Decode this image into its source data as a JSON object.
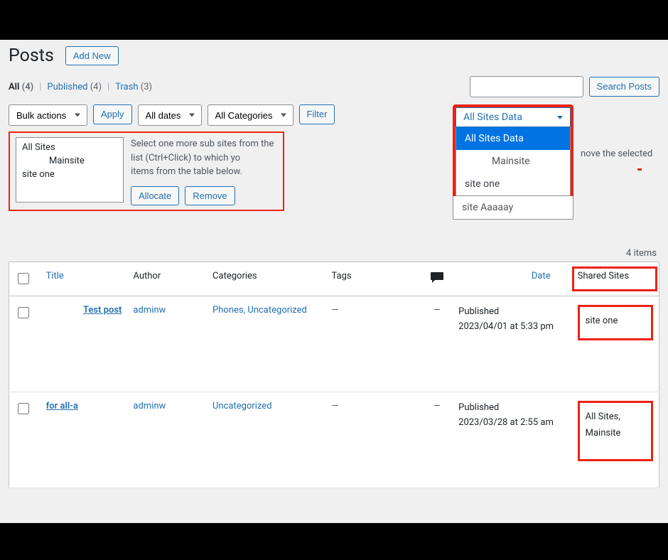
{
  "page": {
    "title": "Posts",
    "add_new": "Add New"
  },
  "views": {
    "all_label": "All",
    "all_count": "(4)",
    "published_label": "Published",
    "published_count": "(4)",
    "trash_label": "Trash",
    "trash_count": "(3)"
  },
  "search": {
    "placeholder": "",
    "button": "Search Posts"
  },
  "filters": {
    "bulk_actions": "Bulk actions",
    "apply": "Apply",
    "all_dates": "All dates",
    "all_categories": "All Categories",
    "filter": "Filter"
  },
  "allocate_panel": {
    "options": [
      "All Sites",
      "Mainsite",
      "site one"
    ],
    "help_text": "Select one more sub sites from the list (Ctrl+Click) to which yo",
    "help_text2": "items from the table below.",
    "behind_text": "nove the selected",
    "allocate_btn": "Allocate",
    "remove_btn": "Remove"
  },
  "sites_dropdown": {
    "trigger": "All Sites Data",
    "options": [
      "All Sites Data",
      "Mainsite",
      "site one"
    ],
    "overflow": "site Aaaaay"
  },
  "list": {
    "items_count": "4 items",
    "columns": {
      "title": "Title",
      "author": "Author",
      "categories": "Categories",
      "tags": "Tags",
      "date": "Date",
      "shared": "Shared Sites"
    },
    "rows": [
      {
        "title": "Test post",
        "author": "adminw",
        "categories": "Phones, Uncategorized",
        "tags": "—",
        "comments": "—",
        "date_status": "Published",
        "date_line": "2023/04/01 at 5:33 pm",
        "shared": "site one"
      },
      {
        "title": "for all-a",
        "author": "adminw",
        "categories": "Uncategorized",
        "tags": "—",
        "comments": "—",
        "date_status": "Published",
        "date_line": "2023/03/28 at 2:55 am",
        "shared": "All Sites, Mainsite"
      }
    ]
  }
}
